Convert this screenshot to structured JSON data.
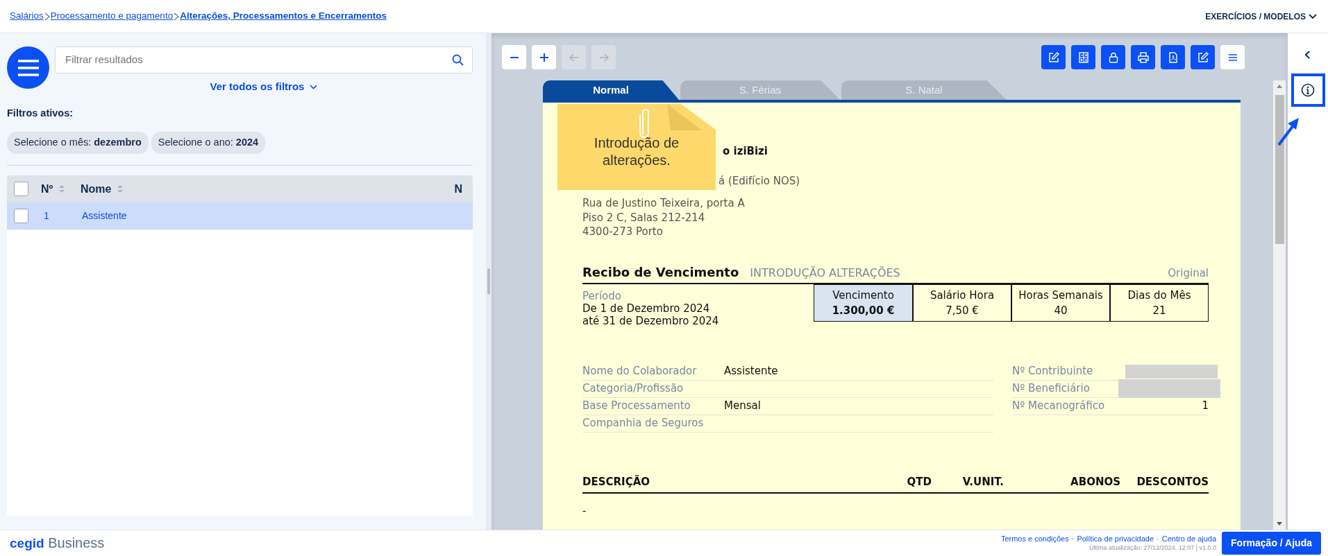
{
  "breadcrumb": [
    {
      "label": "Salários",
      "current": false
    },
    {
      "label": "Processamento e pagamento",
      "current": false
    },
    {
      "label": "Alterações, Processamentos e Encerramentos",
      "current": true
    }
  ],
  "top_menu": {
    "label": "EXERCÍCIOS / MODELOS"
  },
  "filter": {
    "placeholder": "Filtrar resultados",
    "more_filters": "Ver todos os filtros",
    "active_title": "Filtros ativos:",
    "chips": [
      {
        "label": "Selecione o mês:",
        "value": "dezembro"
      },
      {
        "label": "Selecione o ano:",
        "value": "2024"
      }
    ]
  },
  "list": {
    "all_checked": false,
    "columns": [
      {
        "label": "Nº",
        "sortable": true
      },
      {
        "label": "Nome",
        "sortable": true
      },
      {
        "label": "N",
        "sortable": false
      }
    ],
    "rows": [
      {
        "number": "1",
        "name": "Assistente",
        "selected": true,
        "checked": false
      }
    ]
  },
  "toolbar": {
    "left": [
      {
        "kind": "minus",
        "disabled": false
      },
      {
        "kind": "plus",
        "disabled": false
      },
      {
        "kind": "back",
        "disabled": true
      },
      {
        "kind": "forward",
        "disabled": true
      }
    ],
    "right": [
      {
        "kind": "edit",
        "primary": true
      },
      {
        "kind": "calculator",
        "primary": true
      },
      {
        "kind": "lock",
        "primary": true
      },
      {
        "kind": "print",
        "primary": true
      },
      {
        "kind": "pdf",
        "primary": true
      },
      {
        "kind": "edit",
        "primary": true
      },
      {
        "kind": "menu",
        "primary": false
      }
    ]
  },
  "tabs": [
    {
      "label": "Normal",
      "selected": true
    },
    {
      "label": "S. Férias",
      "selected": false
    },
    {
      "label": "S. Natal",
      "selected": false
    }
  ],
  "note": {
    "text": "Introdução de alterações."
  },
  "receipt": {
    "company": "o iziBizi",
    "address": [
      "á (Edifício NOS)",
      "Rua de Justino Teixeira, porta A",
      "Piso 2 C, Salas 212-214",
      "4300-273 Porto"
    ],
    "title": "Recibo de Vencimento",
    "subtitle": "INTRODUÇÃO ALTERAÇÕES",
    "copy": "Original",
    "period_label": "Período",
    "period_lines": [
      "De 1 de Dezembro 2024",
      "até 31 de Dezembro 2024"
    ],
    "figures": [
      {
        "label": "Vencimento",
        "value": "1.300,00 €",
        "highlighted": true
      },
      {
        "label": "Salário Hora",
        "value": "7,50 €",
        "highlighted": false
      },
      {
        "label": "Horas Semanais",
        "value": "40",
        "highlighted": false
      },
      {
        "label": "Dias do Mês",
        "value": "21",
        "highlighted": false
      }
    ],
    "details_left": [
      {
        "label": "Nome do Colaborador",
        "value": "Assistente"
      },
      {
        "label": "Categoria/Profissão"
      },
      {
        "label": "Base Processamento",
        "value": "Mensal"
      },
      {
        "label": "Companhia de Seguros"
      }
    ],
    "details_right": [
      {
        "label": "Nº Contribuinte",
        "redacted": true
      },
      {
        "label": "Nº Beneficiário",
        "redacted": true
      },
      {
        "label": "Nº Mecanográfico",
        "value": "1",
        "redacted": false
      }
    ],
    "line_columns": [
      "DESCRIÇÃO",
      "QTD",
      "V.UNIT.",
      "ABONOS",
      "DESCONTOS"
    ],
    "lines": [
      {
        "description": "-"
      }
    ]
  },
  "rail": {
    "info_highlighted": true
  },
  "footer": {
    "logo_bold": "cegid",
    "logo_light": "Business",
    "links": [
      "Termos e condições",
      "Política de privacidade",
      "Centro de ajuda"
    ],
    "separator": "·",
    "updated": "Última atualização: 27/12/2024, 12:07 | v1.0.0",
    "help_button": "Formação / Ajuda"
  }
}
